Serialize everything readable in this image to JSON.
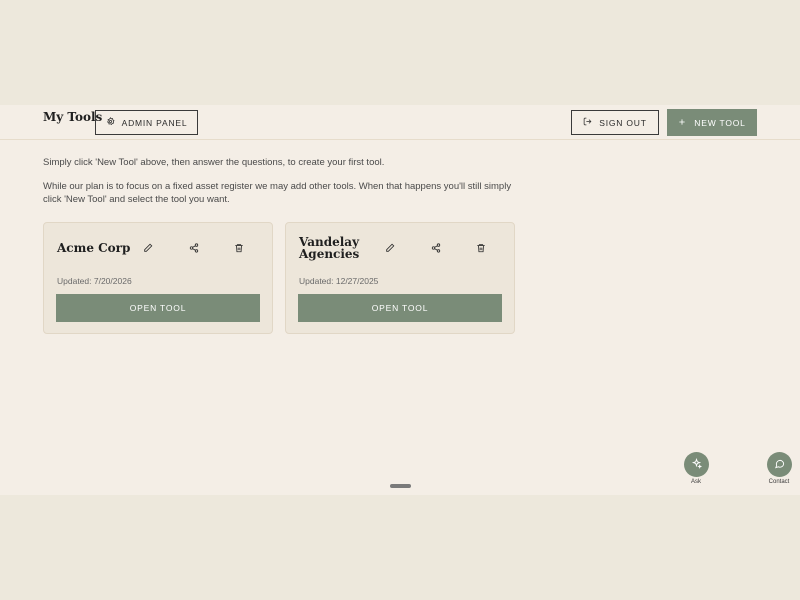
{
  "header": {
    "title": "My Tools",
    "admin_label": "ADMIN PANEL",
    "signout_label": "SIGN OUT",
    "new_tool_label": "NEW TOOL"
  },
  "intro": {
    "line1": "Simply click 'New Tool' above, then answer the questions, to create your first tool.",
    "line2": "While our plan is to focus on a fixed asset register we may add other tools. When that happens you'll still simply click 'New Tool' and select the tool you want."
  },
  "tools": [
    {
      "name": "Acme Corp",
      "updated": "Updated: 7/20/2026",
      "open_label": "OPEN TOOL"
    },
    {
      "name": "Vandelay Agencies",
      "updated": "Updated: 12/27/2025",
      "open_label": "OPEN TOOL"
    }
  ],
  "fabs": {
    "ask_label": "Ask",
    "contact_label": "Contact"
  },
  "colors": {
    "accent": "#7a8c78",
    "panel": "#f4eee6",
    "page": "#ede8dc"
  },
  "icons": [
    "gear-icon",
    "sign-out-icon",
    "plus-icon",
    "pencil-icon",
    "share-icon",
    "trash-icon",
    "sparkle-icon",
    "chat-icon"
  ]
}
